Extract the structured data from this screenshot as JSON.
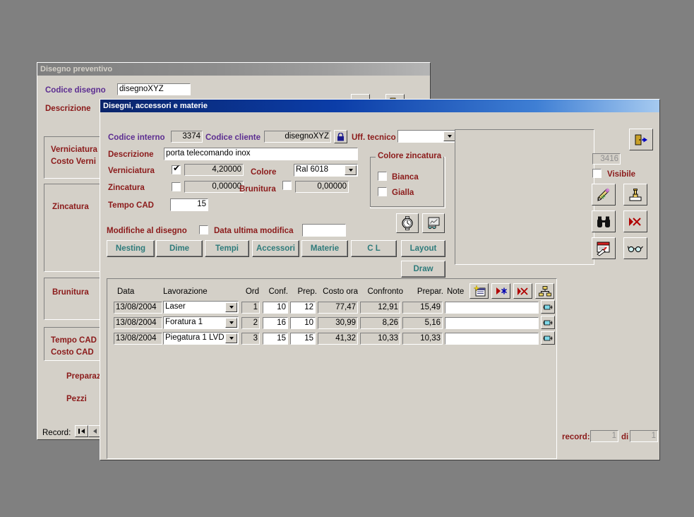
{
  "background_window": {
    "title": "Disegno preventivo",
    "fields": [
      {
        "label": "Codice disegno",
        "value": "disegnoXYZ"
      },
      {
        "label": "Descrizione",
        "value": ""
      }
    ],
    "section_labels": [
      "Verniciatura",
      "Costo Verni",
      "Zincatura",
      "Brunitura",
      "Tempo CAD",
      "Costo CAD",
      "Preparaz",
      "Pezzi"
    ],
    "record_label": "Record:",
    "nav_first_icon": "first-record-icon",
    "nav_prev_icon": "previous-record-icon",
    "toolbar_icons": [
      "delete-record-icon",
      "exit-door-icon"
    ]
  },
  "dialog": {
    "title": "Disegni, accessori e materie",
    "labels": {
      "codice_interno": "Codice interno",
      "codice_cliente": "Codice cliente",
      "uff_tecnico": "Uff. tecnico",
      "descrizione": "Descrizione",
      "verniciatura": "Verniciatura",
      "colore": "Colore",
      "zincatura": "Zincatura",
      "brunitura": "Brunitura",
      "tempo_cad": "Tempo CAD",
      "modifiche": "Modifiche al disegno",
      "data_ultima_modifica": "Data ultima modifica",
      "visibile": "Visibile"
    },
    "values": {
      "codice_interno": "3374",
      "codice_cliente": "disegnoXYZ",
      "uff_tecnico": "",
      "descrizione": "porta telecomando inox",
      "verniciatura_checked": true,
      "verniciatura_value": "4,20000",
      "colore": "Ral 6018",
      "zincatura_checked": false,
      "zincatura_value": "0,00000",
      "brunitura_checked": false,
      "brunitura_value": "0,00000",
      "tempo_cad": "15",
      "modifiche_checked": false,
      "data_ultima_modifica": "",
      "id_readonly": "3416",
      "visibile_checked": false
    },
    "colore_zincatura": {
      "title": "Colore zincatura",
      "options": [
        {
          "label": "Bianca",
          "checked": false
        },
        {
          "label": "Gialla",
          "checked": false
        }
      ]
    },
    "icon_buttons": {
      "lock": "lock-icon",
      "clock": "clock-icon",
      "chart": "chart-presentation-icon",
      "exit": "exit-door-icon",
      "pencil": "pencil-icon",
      "stamp": "stamp-icon",
      "binoculars": "binoculars-icon",
      "delete": "delete-red-x-icon",
      "notes": "notes-write-icon",
      "glasses": "glasses-icon"
    },
    "tab_buttons": [
      "Nesting",
      "Dime",
      "Tempi",
      "Accessori",
      "Materie",
      "C L",
      "Layout"
    ],
    "draw_button": "Draw",
    "grid": {
      "columns": [
        "Data",
        "Lavorazione",
        "Ord",
        "Conf.",
        "Prep.",
        "Costo ora",
        "Confronto",
        "Prepar.",
        "Note"
      ],
      "rows": [
        {
          "data": "13/08/2004",
          "lavorazione": "Laser",
          "ord": "1",
          "conf": "10",
          "prep": "12",
          "costo_ora": "77,47",
          "confronto": "12,91",
          "prepar": "15,49",
          "note": ""
        },
        {
          "data": "13/08/2004",
          "lavorazione": "Foratura 1",
          "ord": "2",
          "conf": "16",
          "prep": "10",
          "costo_ora": "30,99",
          "confronto": "8,26",
          "prepar": "5,16",
          "note": ""
        },
        {
          "data": "13/08/2004",
          "lavorazione": "Piegatura 1 LVD",
          "ord": "3",
          "conf": "15",
          "prep": "15",
          "costo_ora": "41,32",
          "confronto": "10,33",
          "prepar": "10,33",
          "note": ""
        }
      ],
      "toolbar_icons": [
        "new-record-icon",
        "run-asterisk-icon",
        "delete-record-icon",
        "hierarchy-icon"
      ],
      "row_action_icon": "row-detail-icon"
    },
    "footer": {
      "record_label": "record:",
      "record_current": "1",
      "di_label": "di",
      "record_total": "1"
    }
  },
  "colors": {
    "window_face": "#d4d0c8",
    "desktop": "#808080",
    "label_red": "#8b1a1a",
    "label_purple": "#5c2d91",
    "button_text": "#2e7b7b",
    "title_active": "#0a246a"
  }
}
